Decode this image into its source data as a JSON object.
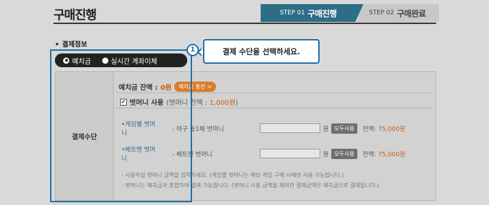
{
  "page_title": "구매진행",
  "steps": [
    {
      "num": "STEP 01",
      "label": "구매진행",
      "active": true
    },
    {
      "num": "STEP 02",
      "label": "구매완료",
      "active": false
    }
  ],
  "section_label": "결제정보",
  "tabs": [
    {
      "label": "예치금",
      "selected": true
    },
    {
      "label": "실시간 계좌이체",
      "selected": false
    }
  ],
  "callout": {
    "number": "1",
    "text": "결제 수단을 선택하세요."
  },
  "panel": {
    "left_label": "결제수단",
    "balance_label": "예치금 잔액 :",
    "balance_value": "0원",
    "charge_button": "예치금 충전 >",
    "use_label": "벗머니 사용",
    "use_sub_prefix": "(벗머니 잔액 :",
    "use_sub_value": "1,000원",
    "use_sub_suffix": ")",
    "money_rows": [
      {
        "name": "•게임별 벗머니",
        "sub": "- 야구 승1패 벗머니",
        "won": "원",
        "all_button": "모두사용",
        "balance_label": "잔액:",
        "balance_value": "75,000원"
      },
      {
        "name": "•베트맨 벗머니",
        "sub": "- 베트맨 벗머니",
        "won": "원",
        "all_button": "모두사용",
        "balance_label": "잔액:",
        "balance_value": "75,000원"
      }
    ],
    "notes": [
      "- 사용하실 벗머니 금액을 입력하세요. (게임별 벗머니는 해당 게임 구매 시에만 사용 가능합니다.)",
      "- 벗머니는 예치금과 혼합하여 결제 가능합니다. (벗머니 사용 금액을 제외한 결제금액은 예치금으로 결제됩니다.)"
    ]
  },
  "colors": {
    "accent": "#2d6e86",
    "highlight": "#1c6ea5",
    "orange": "#c75a12"
  }
}
